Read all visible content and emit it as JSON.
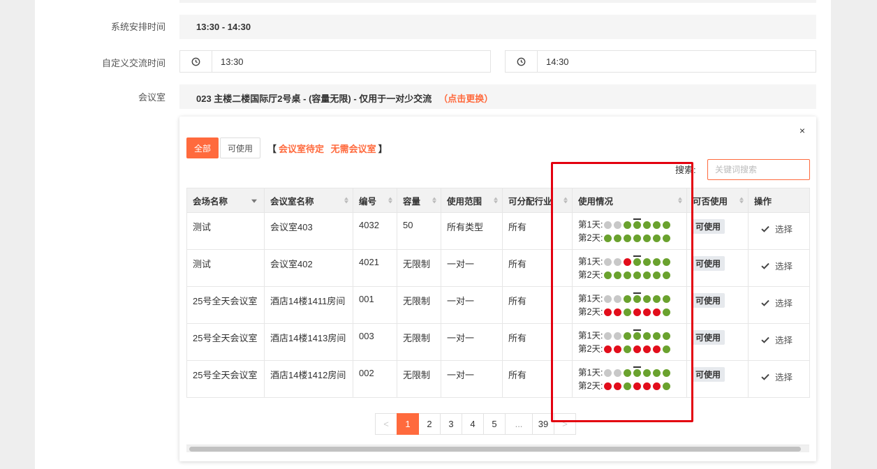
{
  "form": {
    "system_time_label": "系统安排时间",
    "system_time_value": "13:30 - 14:30",
    "custom_time_label": "自定义交流时间",
    "start_time": "13:30",
    "end_time": "14:30",
    "room_label": "会议室",
    "room_value": "023 主楼二楼国际厅2号桌 - (容量无限) - 仅用于一对少交流",
    "room_change_link": "（点击更换）"
  },
  "popup": {
    "close_label": "×",
    "filter_all": "全部",
    "filter_available": "可使用",
    "bracket_open": "【",
    "bracket_close": "】",
    "link_pending": "会议室待定",
    "link_none": "无需会议室",
    "search_label": "搜索:",
    "search_placeholder": "关键词搜索"
  },
  "table": {
    "headers": [
      "会场名称",
      "会议室名称",
      "编号",
      "容量",
      "使用范围",
      "可分配行业",
      "使用情况",
      "可否使用",
      "操作"
    ],
    "day1_label": "第1天:",
    "day2_label": "第2天:",
    "badge_label": "可使用",
    "action_label": "选择",
    "rows": [
      {
        "venue": "测试",
        "room": "会议室403",
        "code": "4032",
        "capacity": "50",
        "scope": "所有类型",
        "industry": "所有",
        "day1": [
          "x",
          "x",
          "g",
          "g",
          "g",
          "g",
          "g"
        ],
        "day2": [
          "g",
          "g",
          "g",
          "g",
          "g",
          "g",
          "g"
        ]
      },
      {
        "venue": "测试",
        "room": "会议室402",
        "code": "4021",
        "capacity": "无限制",
        "scope": "一对一",
        "industry": "所有",
        "day1": [
          "x",
          "x",
          "r",
          "g",
          "g",
          "g",
          "g"
        ],
        "day2": [
          "g",
          "g",
          "g",
          "g",
          "g",
          "g",
          "g"
        ]
      },
      {
        "venue": "25号全天会议室",
        "room": "酒店14楼1411房间",
        "code": "001",
        "capacity": "无限制",
        "scope": "一对一",
        "industry": "所有",
        "day1": [
          "x",
          "x",
          "g",
          "g",
          "g",
          "g",
          "g"
        ],
        "day2": [
          "r",
          "r",
          "g",
          "r",
          "r",
          "r",
          "g"
        ]
      },
      {
        "venue": "25号全天会议室",
        "room": "酒店14楼1413房间",
        "code": "003",
        "capacity": "无限制",
        "scope": "一对一",
        "industry": "所有",
        "day1": [
          "x",
          "x",
          "g",
          "g",
          "g",
          "g",
          "g"
        ],
        "day2": [
          "r",
          "r",
          "g",
          "r",
          "r",
          "r",
          "g"
        ]
      },
      {
        "venue": "25号全天会议室",
        "room": "酒店14楼1412房间",
        "code": "002",
        "capacity": "无限制",
        "scope": "一对一",
        "industry": "所有",
        "day1": [
          "x",
          "x",
          "g",
          "g",
          "g",
          "g",
          "g"
        ],
        "day2": [
          "r",
          "r",
          "g",
          "r",
          "r",
          "r",
          "g"
        ]
      }
    ]
  },
  "pagination": {
    "prev": "<",
    "pages": [
      "1",
      "2",
      "3",
      "4",
      "5"
    ],
    "ellipsis": "...",
    "last": "39",
    "next": ">",
    "current": "1"
  },
  "colors": {
    "accent": "#ff6a3d",
    "available_dot": "#6aa22e",
    "occupied_dot": "#e20d1b",
    "disabled_dot": "#c8c8c8",
    "highlight": "#e3000f"
  }
}
